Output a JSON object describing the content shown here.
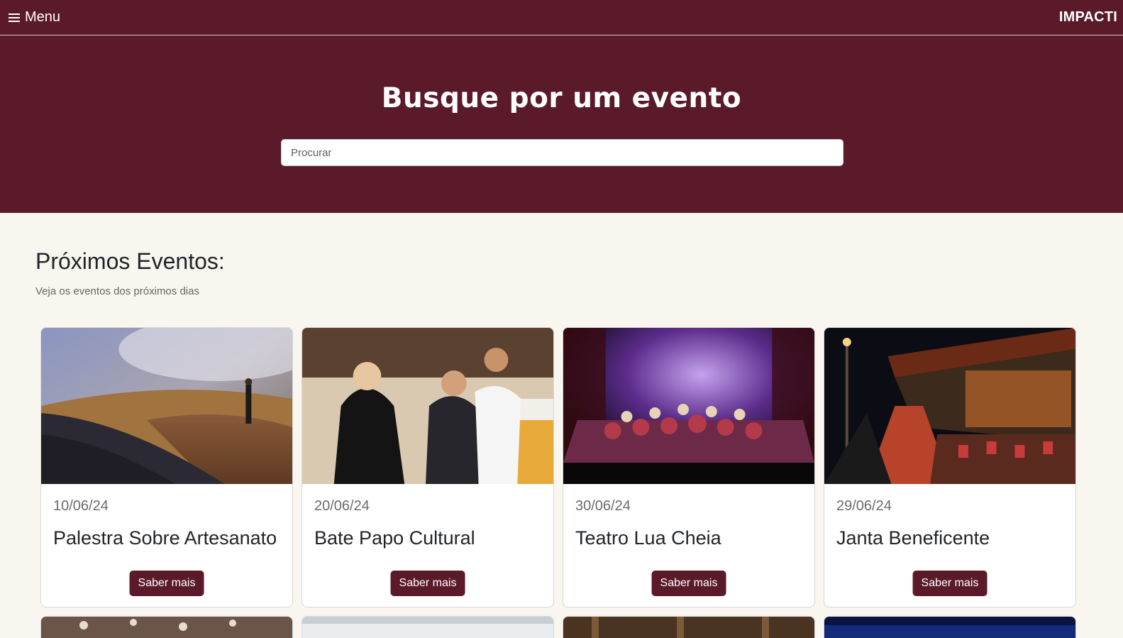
{
  "navbar": {
    "menu_label": "Menu",
    "brand": "IMPACTI"
  },
  "hero": {
    "title": "Busque por um evento",
    "search_placeholder": "Procurar"
  },
  "section": {
    "title": "Próximos Eventos:",
    "subtitle": "Veja os eventos dos próximos dias"
  },
  "events": [
    {
      "date": "10/06/24",
      "title": "Palestra Sobre Artesanato",
      "button": "Saber mais"
    },
    {
      "date": "20/06/24",
      "title": "Bate Papo Cultural",
      "button": "Saber mais"
    },
    {
      "date": "30/06/24",
      "title": "Teatro Lua Cheia",
      "button": "Saber mais"
    },
    {
      "date": "29/06/24",
      "title": "Janta Beneficente",
      "button": "Saber mais"
    }
  ],
  "colors": {
    "primary": "#5a1a2a",
    "background": "#f8f6ef"
  }
}
